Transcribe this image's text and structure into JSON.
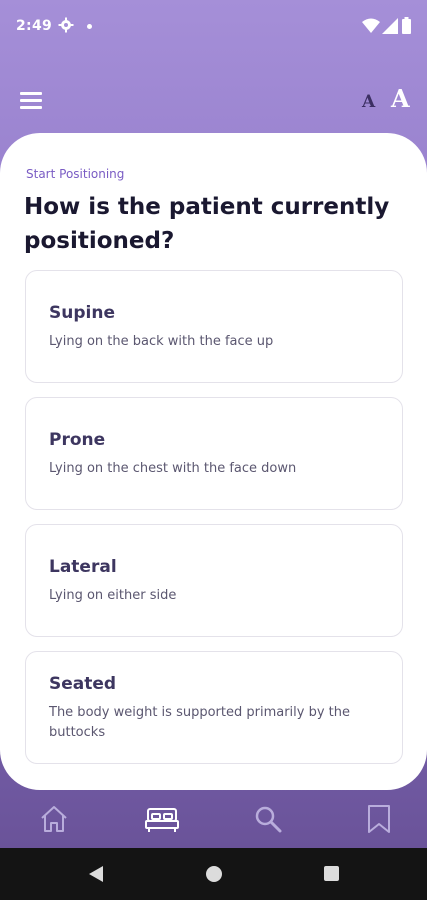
{
  "status": {
    "time": "2:49"
  },
  "header": {
    "font_small_label": "A",
    "font_large_label": "A"
  },
  "main": {
    "section_label": "Start Positioning",
    "question": "How is the patient currently positioned?",
    "options": [
      {
        "title": "Supine",
        "description": "Lying on the back with the face up"
      },
      {
        "title": "Prone",
        "description": "Lying on the chest with the face down"
      },
      {
        "title": "Lateral",
        "description": "Lying on either side"
      },
      {
        "title": "Seated",
        "description": "The body weight is supported primarily by the buttocks"
      }
    ]
  },
  "bottom_nav": {
    "items": [
      {
        "icon": "home-icon",
        "active": false
      },
      {
        "icon": "bed-icon",
        "active": true
      },
      {
        "icon": "search-icon",
        "active": false
      },
      {
        "icon": "bookmark-icon",
        "active": false
      }
    ]
  },
  "colors": {
    "accent": "#7a5cc4",
    "header_gradient_top": "#a58fd8",
    "nav_icon": "#b9addc",
    "nav_icon_active": "#ffffff"
  }
}
